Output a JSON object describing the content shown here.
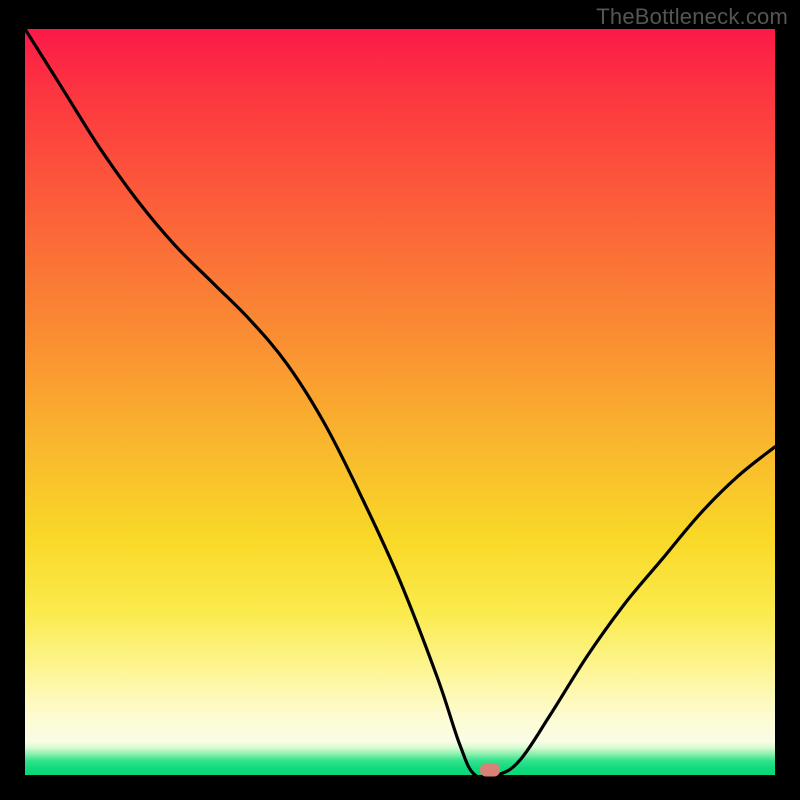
{
  "watermark": "TheBottleneck.com",
  "colors": {
    "background": "#000000",
    "curve": "#000000",
    "marker": "#d98077",
    "gradient_top": "#fb1a49",
    "gradient_bottom": "#0bd777"
  },
  "chart_data": {
    "type": "line",
    "title": "",
    "xlabel": "",
    "ylabel": "",
    "xlim": [
      0,
      100
    ],
    "ylim": [
      0,
      100
    ],
    "grid": false,
    "legend": false,
    "annotations": [
      {
        "type": "marker",
        "x": 62,
        "y": 0,
        "shape": "rounded-rect",
        "color": "#d98077"
      }
    ],
    "series": [
      {
        "name": "bottleneck-curve",
        "color": "#000000",
        "x": [
          0,
          5,
          10,
          15,
          20,
          25,
          30,
          35,
          40,
          45,
          50,
          55,
          58,
          60,
          63,
          66,
          70,
          75,
          80,
          85,
          90,
          95,
          100
        ],
        "values": [
          100,
          92,
          84,
          77,
          71,
          66,
          61,
          55,
          47,
          37,
          26,
          13,
          4,
          0,
          0,
          2,
          8,
          16,
          23,
          29,
          35,
          40,
          44
        ]
      }
    ]
  }
}
